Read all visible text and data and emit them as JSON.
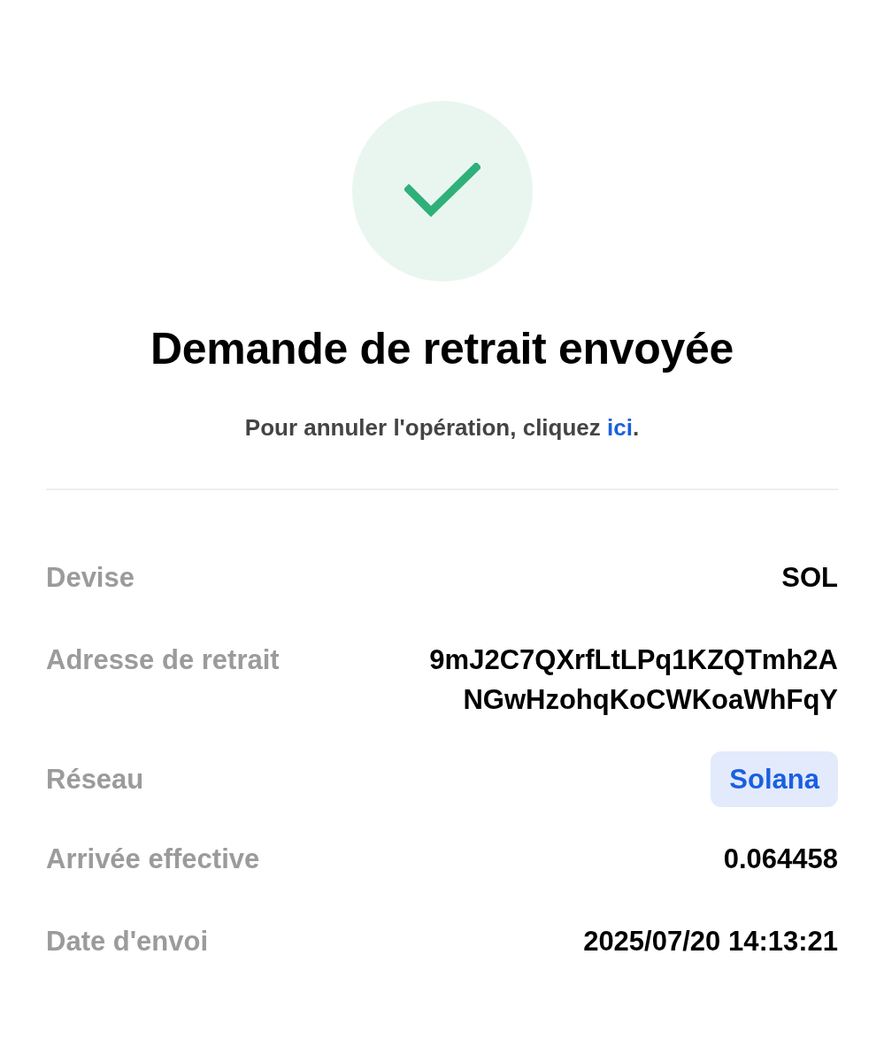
{
  "title": "Demande de retrait envoyée",
  "cancel_note": {
    "before": "Pour annuler l'opération, cliquez ",
    "link": "ici",
    "after": "."
  },
  "details": [
    {
      "label": "Devise",
      "value": "SOL",
      "kind": "text"
    },
    {
      "label": "Adresse de retrait",
      "value": "9mJ2C7QXrfLtLPq1KZQTmh2ANGwHzohqKoCWKoaWhFqY",
      "kind": "text"
    },
    {
      "label": "Réseau",
      "value": "Solana",
      "kind": "badge"
    },
    {
      "label": "Arrivée effective",
      "value": "0.064458",
      "kind": "text"
    },
    {
      "label": "Date d'envoi",
      "value": "2025/07/20 14:13:21",
      "kind": "text"
    }
  ]
}
